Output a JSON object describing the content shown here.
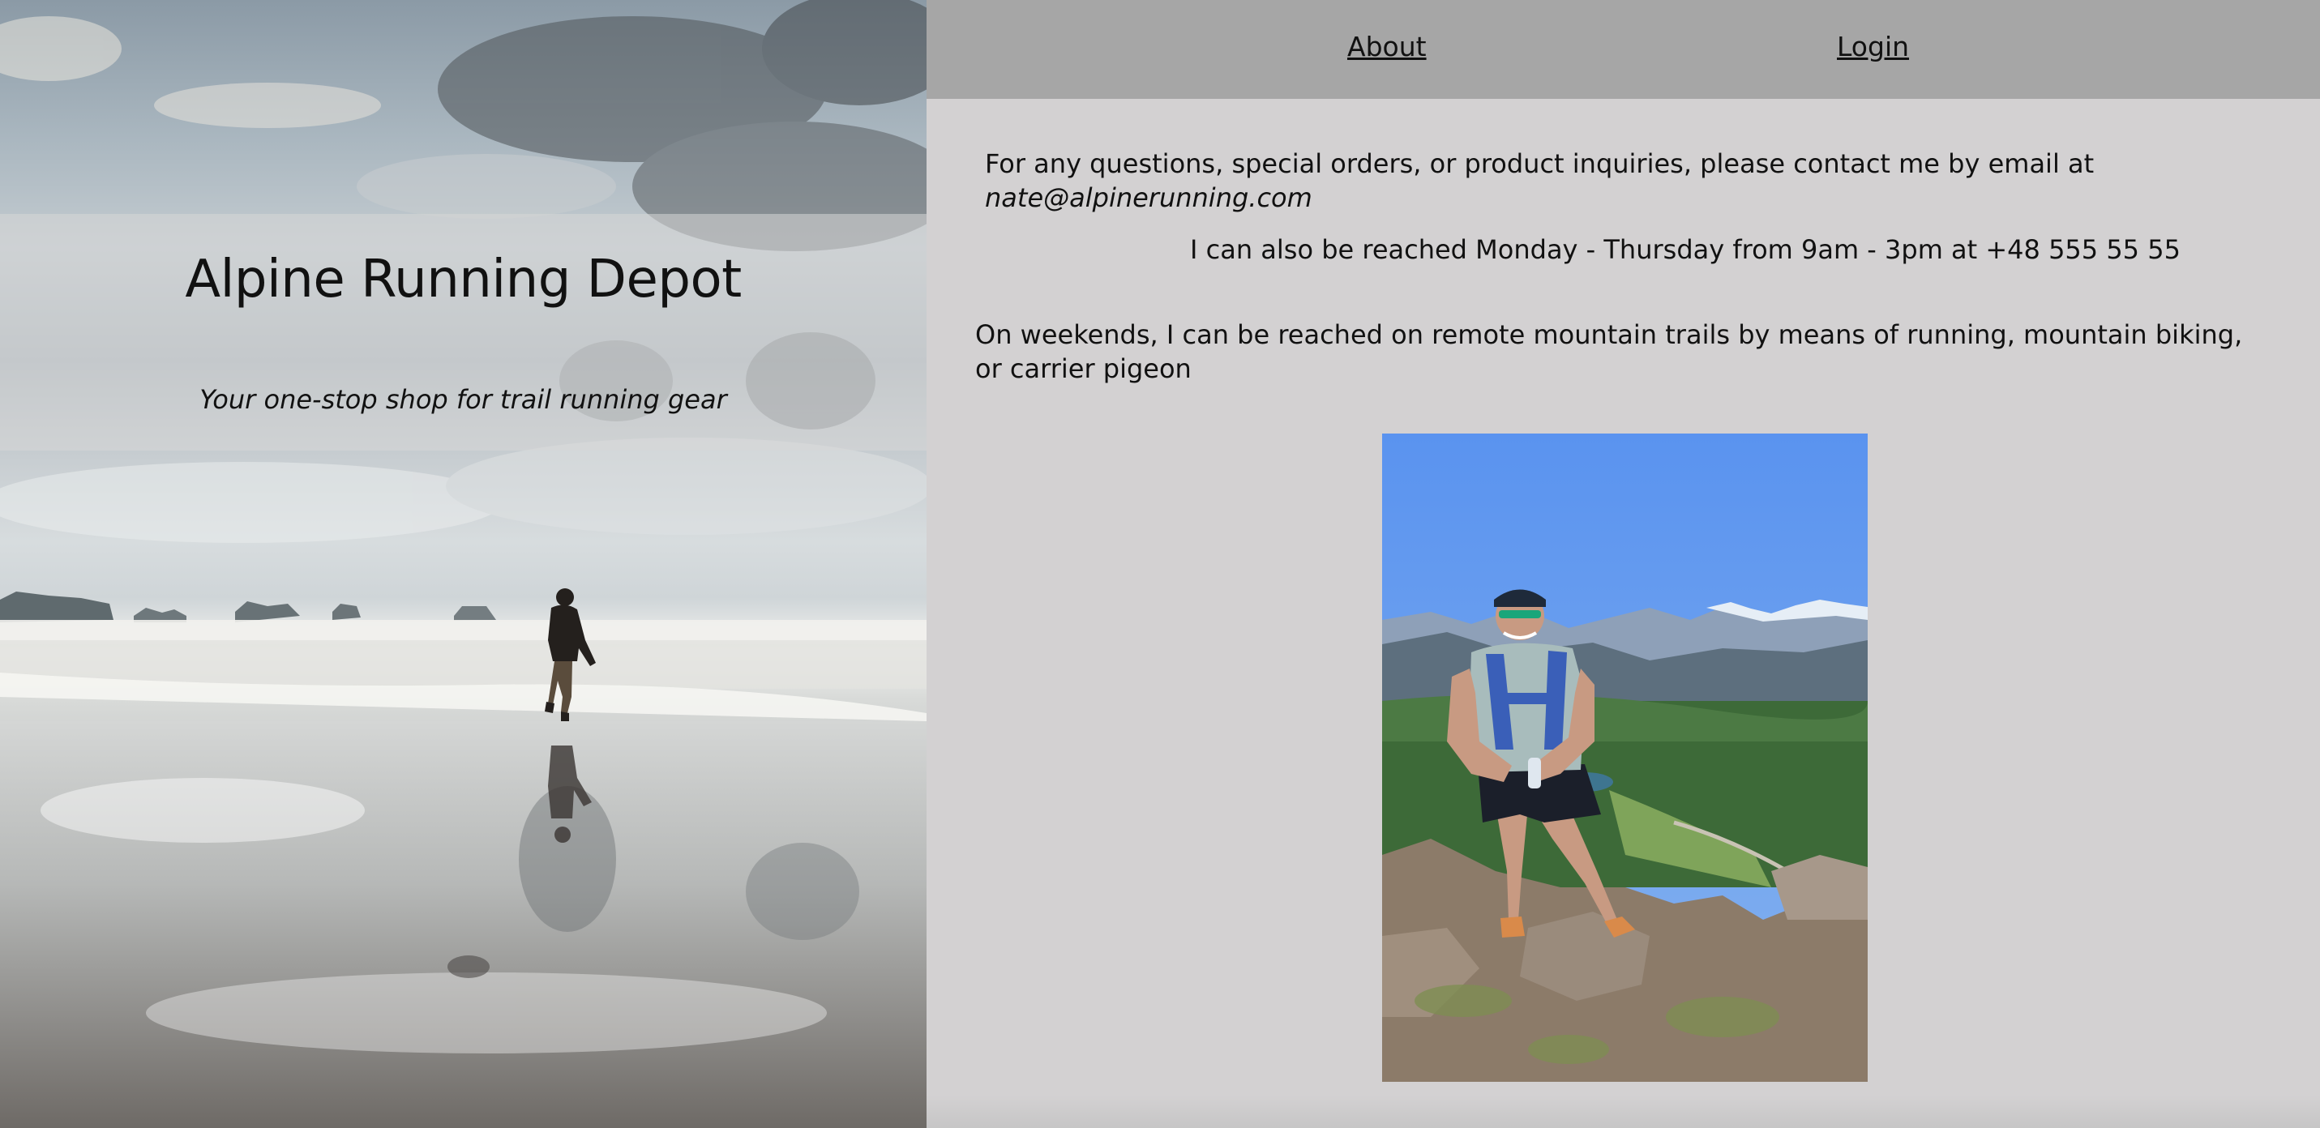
{
  "hero": {
    "title": "Alpine Running Depot",
    "tagline": "Your one-stop shop for trail running gear"
  },
  "nav": {
    "about_label": "About",
    "login_label": "Login"
  },
  "contact": {
    "line1_text": "For any questions, special orders, or product inquiries, please contact me by email at ",
    "email": "nate@alpinerunning.com",
    "line2_text": "I can also be reached Monday - Thursday from 9am - 3pm at +48 555 55 55",
    "line3_text": "On weekends, I can be reached on remote mountain trails by means of running, mountain biking, or carrier pigeon"
  },
  "colors": {
    "nav_bg": "#a6a6a6",
    "content_bg": "#d3d1d2",
    "sky_blue": "#5b95f0"
  }
}
